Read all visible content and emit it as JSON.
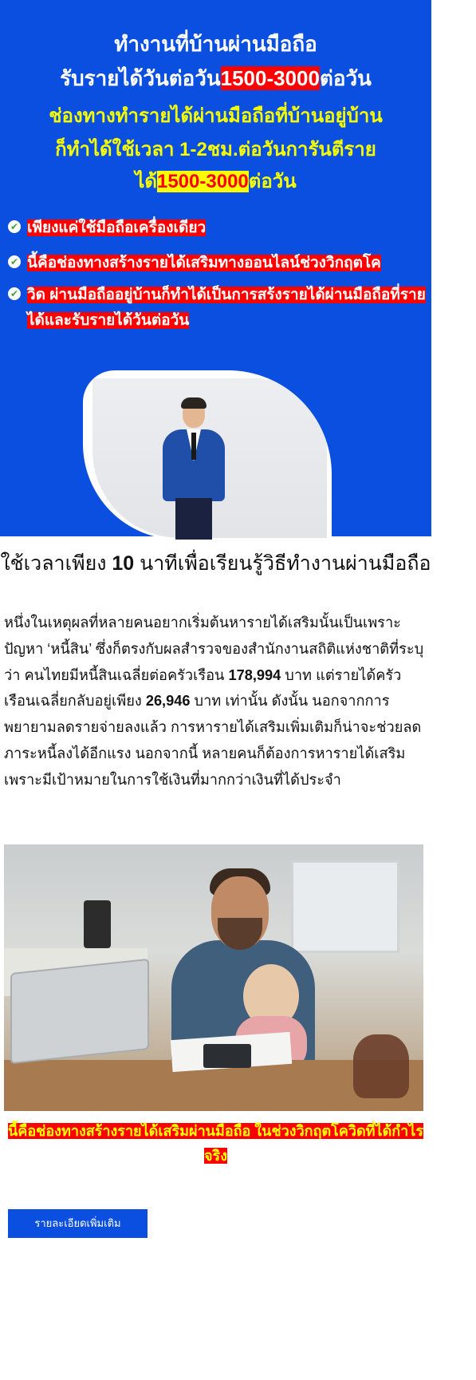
{
  "hero": {
    "title_line1": "ทำงานที่บ้านผ่านมือถือ",
    "title_line2_pre": "รับรายได้วันต่อวัน",
    "title_line2_hl": "1500-3000",
    "title_line2_post": "ต่อวัน",
    "sub_line1": "ช่องทางทำรายได้ผ่านมือถือที่บ้านอยู่บ้าน",
    "sub_line2": "ก็ทำได้ใช้เวลา 1-2ชม.ต่อวันการันตีราย",
    "sub_line3_pre": "ได้",
    "sub_line3_hl": "1500-3000",
    "sub_line3_post": "ต่อวัน",
    "bullets": [
      "เพียงแค่ใช้มือถือเครื่องเดียว",
      "นี้คือช่องทางสร้างรายได้เสริมทางออนไลน์ช่วงวิกฤตโค",
      "วิด ผ่านมือถืออยู่บ้านก็ทำได้เป็นการสร้งรายได้ผ่านมือถือที่รายได้และรับรายได้วันต่อวัน"
    ],
    "colors": {
      "background": "#0a4fe0",
      "highlight_red": "#ff0000",
      "subtitle_yellow": "#f6ff00"
    }
  },
  "article": {
    "title_pre": "ใช้เวลาเพียง ",
    "title_num": "10",
    "title_post": " นาทีเพื่อเรียนรู้วิธีทำงานผ่านมือถือ",
    "para_1": "หนึ่งในเหตุผลที่หลายคนอยากเริ่มต้นหารายได้เสริมนั้นเป็นเพราะปัญหา ‘หนี้สิน’ ซึ่งก็ตรงกับผลสำรวจของสำนักงานสถิติแห่งชาติที่ระบุว่า คนไทยมีหนี้สินเฉลี่ยต่อครัวเรือน ",
    "num_1": "178,994",
    "para_2": " บาท แต่รายได้ครัวเรือนเฉลี่ยกลับอยู่เพียง ",
    "num_2": "26,946",
    "para_3": " บาท เท่านั้น ดังนั้น นอกจากการพยายามลดรายจ่ายลงแล้ว การหารายได้เสริมเพิ่มเติมก็น่าจะช่วยลดภาระหนี้ลงได้อีกแรง นอกจากนี้ หลายคนก็ต้องการหารายได้เสริมเพราะมีเป้าหมายในการใช้เงินที่มากกว่าเงินที่ได้ประจำ",
    "caption": "นี้คือช่องทางสร้างรายได้เสริมผ่านมือถือ ในช่วงวิกฤตโควิดที่ได้กำไรจริง"
  },
  "cta": {
    "more_label": "รายละเอียดเพิ่มเติม"
  },
  "icons": {
    "bullet": "check-circle-icon"
  }
}
